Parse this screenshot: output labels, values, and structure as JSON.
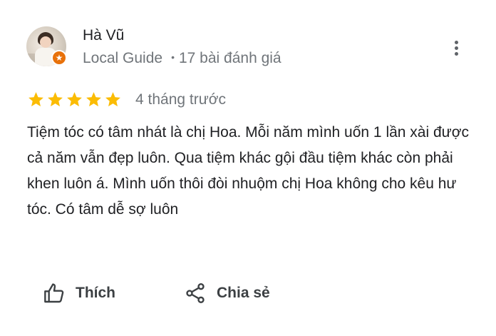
{
  "reviewer": {
    "name": "Hà Vũ",
    "badge": "Local Guide",
    "review_count": "17 bài đánh giá"
  },
  "rating": {
    "stars": 5,
    "max": 5,
    "color": "#fbbc04"
  },
  "time": "4 tháng trước",
  "review_text": "Tiệm tóc có tâm nhát là chị Hoa. Mỗi năm mình uốn 1 lần xài được cả năm vẫn đẹp luôn. Qua tiệm khác gội đầu tiệm khác còn phải khen luôn á. Mình uốn thôi đòi nhuộm chị Hoa không cho kêu hư tóc. Có tâm dễ sợ luôn",
  "actions": {
    "like_label": "Thích",
    "share_label": "Chia sẻ"
  },
  "icons": {
    "more": "more-vert-icon",
    "like": "thumb-up-icon",
    "share": "share-icon",
    "guide": "local-guide-star-icon"
  }
}
